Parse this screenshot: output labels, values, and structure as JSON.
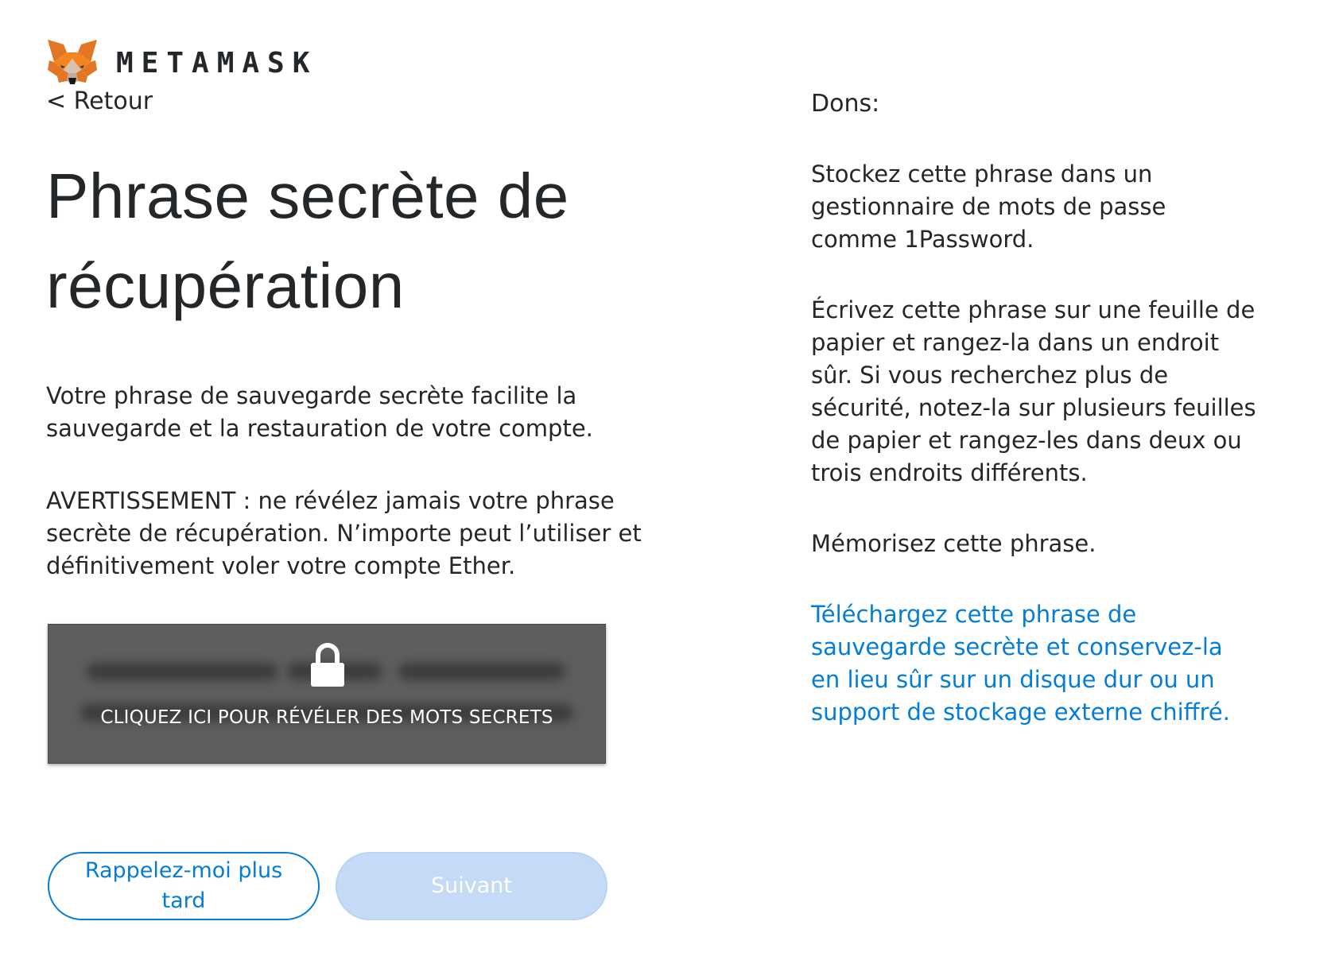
{
  "header": {
    "brand": "METAMASK",
    "logo_icon": "metamask-fox-icon",
    "back_label": "< Retour"
  },
  "main": {
    "title": "Phrase secrète de récupération",
    "description": "Votre phrase de sauvegarde secrète facilite la sauvegarde et la restauration de votre compte.",
    "warning": "AVERTISSEMENT : ne révélez jamais votre phrase secrète de récupération. N’importe peut l’utiliser et définitivement voler votre compte Ether.",
    "reveal": {
      "label": "CLIQUEZ ICI POUR RÉVÉLER DES MOTS SECRETS",
      "icon": "lock-icon"
    },
    "buttons": {
      "remind_later": "Rappelez-moi plus tard",
      "next": "Suivant"
    }
  },
  "tips": {
    "title": "Dons:",
    "items": [
      "Stockez cette phrase dans un gestionnaire de mots de passe comme 1Password.",
      "Écrivez cette phrase sur une feuille de papier et rangez-la dans un endroit sûr. Si vous recherchez plus de sécurité, notez-la sur plusieurs feuilles de papier et rangez-les dans deux ou trois endroits différents.",
      "Mémorisez cette phrase."
    ],
    "download_link": "Téléchargez cette phrase de sauvegarde secrète et conservez-la en lieu sûr sur un disque dur ou un support de stockage externe chiffré."
  },
  "colors": {
    "accent": "#037dd6",
    "disabled_button": "#c5daf6",
    "reveal_background": "#5e5e5e",
    "text": "#24272a"
  }
}
